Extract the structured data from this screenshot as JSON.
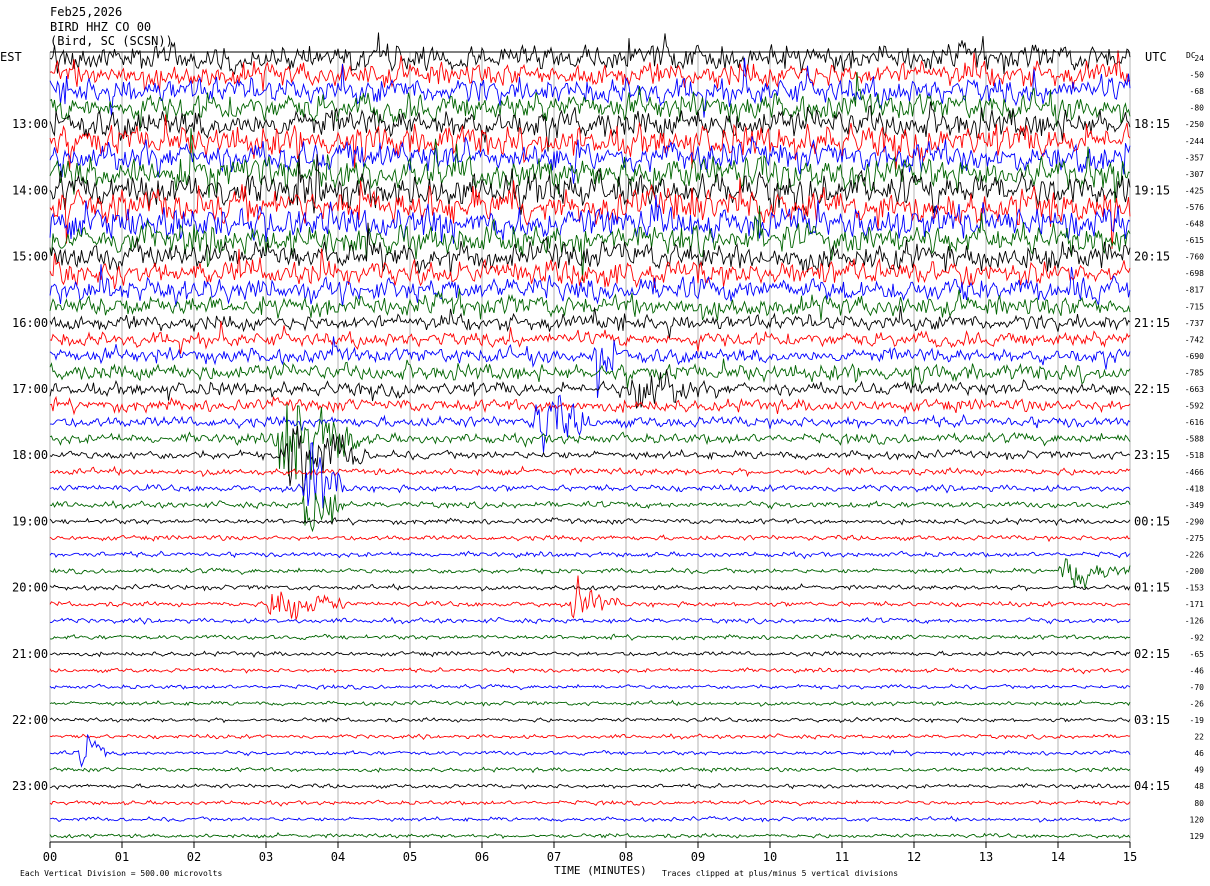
{
  "chart_data": {
    "type": "line",
    "header": {
      "date": "Feb25,2026",
      "station": "BIRD HHZ CO 00",
      "location": "(Bird, SC (SCSN))"
    },
    "left_tz": "EST",
    "right_tz": "UTC",
    "dc_label": "DC",
    "xlabel": "TIME (MINUTES)",
    "x_ticks": [
      "00",
      "01",
      "02",
      "03",
      "04",
      "05",
      "06",
      "07",
      "08",
      "09",
      "10",
      "11",
      "12",
      "13",
      "14",
      "15"
    ],
    "xlim": [
      0,
      15
    ],
    "left_hour_labels": [
      {
        "label": "13:00",
        "trace": 4
      },
      {
        "label": "14:00",
        "trace": 8
      },
      {
        "label": "15:00",
        "trace": 12
      },
      {
        "label": "16:00",
        "trace": 16
      },
      {
        "label": "17:00",
        "trace": 20
      },
      {
        "label": "18:00",
        "trace": 24
      },
      {
        "label": "19:00",
        "trace": 28
      },
      {
        "label": "20:00",
        "trace": 32
      },
      {
        "label": "21:00",
        "trace": 36
      },
      {
        "label": "22:00",
        "trace": 40
      },
      {
        "label": "23:00",
        "trace": 44
      }
    ],
    "right_hour_labels": [
      {
        "label": "18:15",
        "trace": 4
      },
      {
        "label": "19:15",
        "trace": 8
      },
      {
        "label": "20:15",
        "trace": 12
      },
      {
        "label": "21:15",
        "trace": 16
      },
      {
        "label": "22:15",
        "trace": 20
      },
      {
        "label": "23:15",
        "trace": 24
      },
      {
        "label": "00:15",
        "trace": 28
      },
      {
        "label": "01:15",
        "trace": 32
      },
      {
        "label": "02:15",
        "trace": 36
      },
      {
        "label": "03:15",
        "trace": 40
      },
      {
        "label": "04:15",
        "trace": 44
      }
    ],
    "dc_offsets": [
      "24",
      "-50",
      "-68",
      "-80",
      "-250",
      "-244",
      "-357",
      "-307",
      "-425",
      "-576",
      "-648",
      "-615",
      "-760",
      "-698",
      "-817",
      "-715",
      "-737",
      "-742",
      "-690",
      "-785",
      "-663",
      "-592",
      "-616",
      "-588",
      "-518",
      "-466",
      "-418",
      "-349",
      "-290",
      "-275",
      "-226",
      "-200",
      "-153",
      "-171",
      "-126",
      "-92",
      "-65",
      "-46",
      "-70",
      "-26",
      "-19",
      "22",
      "46",
      "49",
      "48",
      "80",
      "120",
      "129"
    ],
    "trace_colors": [
      "#000000",
      "#ff0000",
      "#0000ff",
      "#006400"
    ],
    "noise_levels": [
      3.2,
      3.0,
      3.1,
      3.3,
      3.6,
      3.8,
      3.6,
      3.8,
      4.0,
      4.2,
      4.0,
      3.6,
      3.3,
      3.0,
      2.8,
      2.6,
      1.9,
      1.7,
      1.8,
      2.0,
      1.6,
      1.5,
      1.3,
      1.2,
      1.0,
      0.85,
      0.8,
      0.75,
      0.65,
      0.6,
      0.6,
      0.6,
      0.6,
      0.6,
      0.6,
      0.55,
      0.55,
      0.5,
      0.5,
      0.5,
      0.5,
      0.5,
      0.5,
      0.5,
      0.5,
      0.5,
      0.5,
      0.5
    ],
    "events": [
      {
        "trace": 23,
        "start_min": 3.1,
        "end_min": 4.3,
        "amp": 3.0
      },
      {
        "trace": 24,
        "start_min": 3.2,
        "end_min": 4.4,
        "amp": 2.2
      },
      {
        "trace": 26,
        "start_min": 3.5,
        "end_min": 4.1,
        "amp": 2.6
      },
      {
        "trace": 27,
        "start_min": 3.5,
        "end_min": 4.1,
        "amp": 2.4
      },
      {
        "trace": 22,
        "start_min": 6.7,
        "end_min": 7.5,
        "amp": 1.8
      },
      {
        "trace": 33,
        "start_min": 3.0,
        "end_min": 4.1,
        "amp": 1.3
      },
      {
        "trace": 33,
        "start_min": 7.2,
        "end_min": 7.9,
        "amp": 1.0
      },
      {
        "trace": 18,
        "start_min": 7.5,
        "end_min": 8.0,
        "amp": 1.5
      },
      {
        "trace": 42,
        "start_min": 0.4,
        "end_min": 0.8,
        "amp": 1.2
      },
      {
        "trace": 31,
        "start_min": 14.0,
        "end_min": 15.0,
        "amp": 1.0
      },
      {
        "trace": 20,
        "start_min": 8.0,
        "end_min": 9.0,
        "amp": 1.4
      }
    ],
    "footer_left": "Each Vertical Division =  500.00 microvolts",
    "footer_right": "Traces clipped at plus/minus 5 vertical divisions"
  }
}
